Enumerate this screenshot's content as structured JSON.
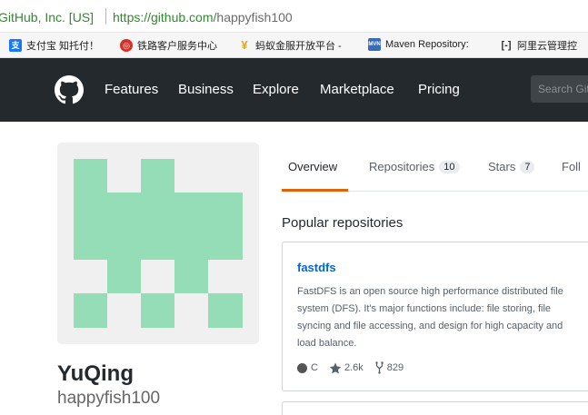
{
  "browser": {
    "site_identity": "GitHub, Inc. [US]",
    "url_host": "https://github.com/",
    "url_path": "happyfish100"
  },
  "bookmarks": [
    {
      "label": "支付宝 知托付！",
      "icon": "alipay-icon",
      "color": "#1677ff"
    },
    {
      "label": "铁路客户服务中心",
      "icon": "railway-icon",
      "color": "#d93025"
    },
    {
      "label": "蚂蚁金服开放平台 -",
      "icon": "ant-icon",
      "color": "#e8a317"
    },
    {
      "label": "Maven Repository:",
      "icon": "maven-icon",
      "color": "#3b6bb5"
    },
    {
      "label": "阿里云管理控",
      "icon": "aliyun-icon",
      "color": "#333333"
    }
  ],
  "header": {
    "nav": [
      "Features",
      "Business",
      "Explore",
      "Marketplace",
      "Pricing"
    ],
    "search_placeholder": "Search GitHub",
    "bg_color": "#24292e"
  },
  "profile": {
    "fullname": "YuQing",
    "username": "happyfish100",
    "avatar_color": "#94ddb6"
  },
  "tabs": [
    {
      "label": "Overview",
      "count": null,
      "active": true
    },
    {
      "label": "Repositories",
      "count": "10",
      "active": false
    },
    {
      "label": "Stars",
      "count": "7",
      "active": false
    },
    {
      "label": "Foll",
      "count": null,
      "active": false
    }
  ],
  "popular": {
    "title": "Popular repositories",
    "repos": [
      {
        "name": "fastdfs",
        "description": "FastDFS is an open source high performance distributed file system (DFS). It's major functions include: file storing, file syncing and file accessing, and design for high capacity and load balance.",
        "language": "C",
        "language_color": "#555555",
        "stars": "2.6k",
        "forks": "829"
      }
    ]
  }
}
